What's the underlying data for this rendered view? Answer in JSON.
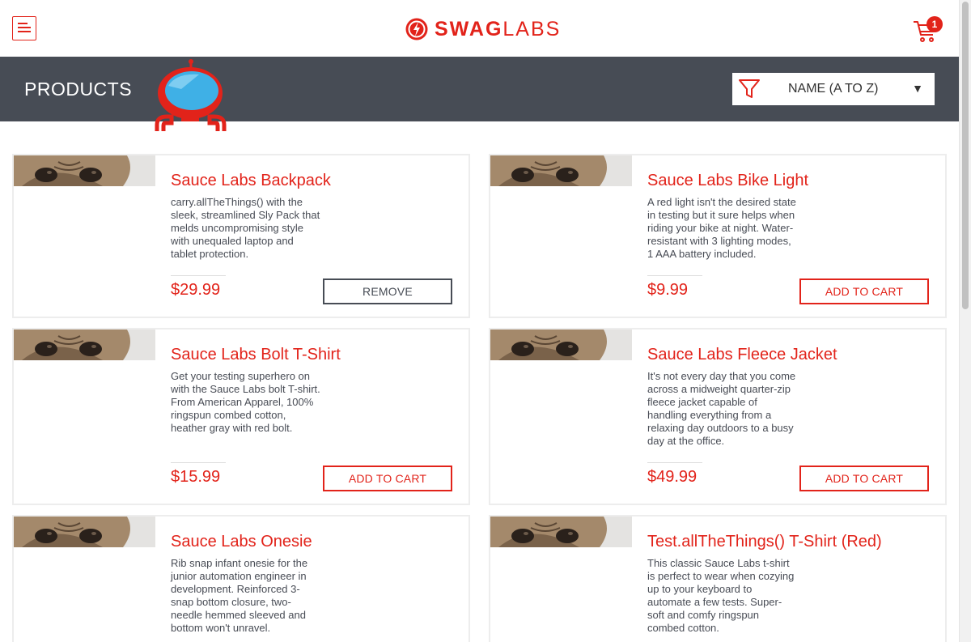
{
  "header": {
    "logo_bold": "SWAG",
    "logo_light": "LABS",
    "cart_count": "1",
    "icons": {
      "menu": "hamburger-menu-icon",
      "cart": "shopping-cart-icon",
      "logo": "swag-labs-logo-icon"
    }
  },
  "subheader": {
    "title": "PRODUCTS",
    "sort_selected": "NAME (A TO Z)",
    "sort_caret": "▼",
    "icons": {
      "filter": "filter-icon",
      "mascot": "robot-mascot-icon"
    }
  },
  "colors": {
    "accent": "#e2231a",
    "bar": "#474c55",
    "text": "#484c55"
  },
  "products": [
    {
      "name": "Sauce Labs Backpack",
      "desc": "carry.allTheThings() with the sleek, streamlined Sly Pack that melds uncompromising style with unequaled laptop and tablet protection.",
      "price": "$29.99",
      "button": "REMOVE"
    },
    {
      "name": "Sauce Labs Bike Light",
      "desc": "A red light isn't the desired state in testing but it sure helps when riding your bike at night. Water-resistant with 3 lighting modes, 1 AAA battery included.",
      "price": "$9.99",
      "button": "ADD TO CART"
    },
    {
      "name": "Sauce Labs Bolt T-Shirt",
      "desc": "Get your testing superhero on with the Sauce Labs bolt T-shirt. From American Apparel, 100% ringspun combed cotton, heather gray with red bolt.",
      "price": "$15.99",
      "button": "ADD TO CART"
    },
    {
      "name": "Sauce Labs Fleece Jacket",
      "desc": "It's not every day that you come across a midweight quarter-zip fleece jacket capable of handling everything from a relaxing day outdoors to a busy day at the office.",
      "price": "$49.99",
      "button": "ADD TO CART"
    },
    {
      "name": "Sauce Labs Onesie",
      "desc": "Rib snap infant onesie for the junior automation engineer in development. Reinforced 3-snap bottom closure, two-needle hemmed sleeved and bottom won't unravel.",
      "price": "",
      "button": ""
    },
    {
      "name": "Test.allTheThings() T-Shirt (Red)",
      "desc": "This classic Sauce Labs t-shirt is perfect to wear when cozying up to your keyboard to automate a few tests. Super-soft and comfy ringspun combed cotton.",
      "price": "",
      "button": ""
    }
  ]
}
